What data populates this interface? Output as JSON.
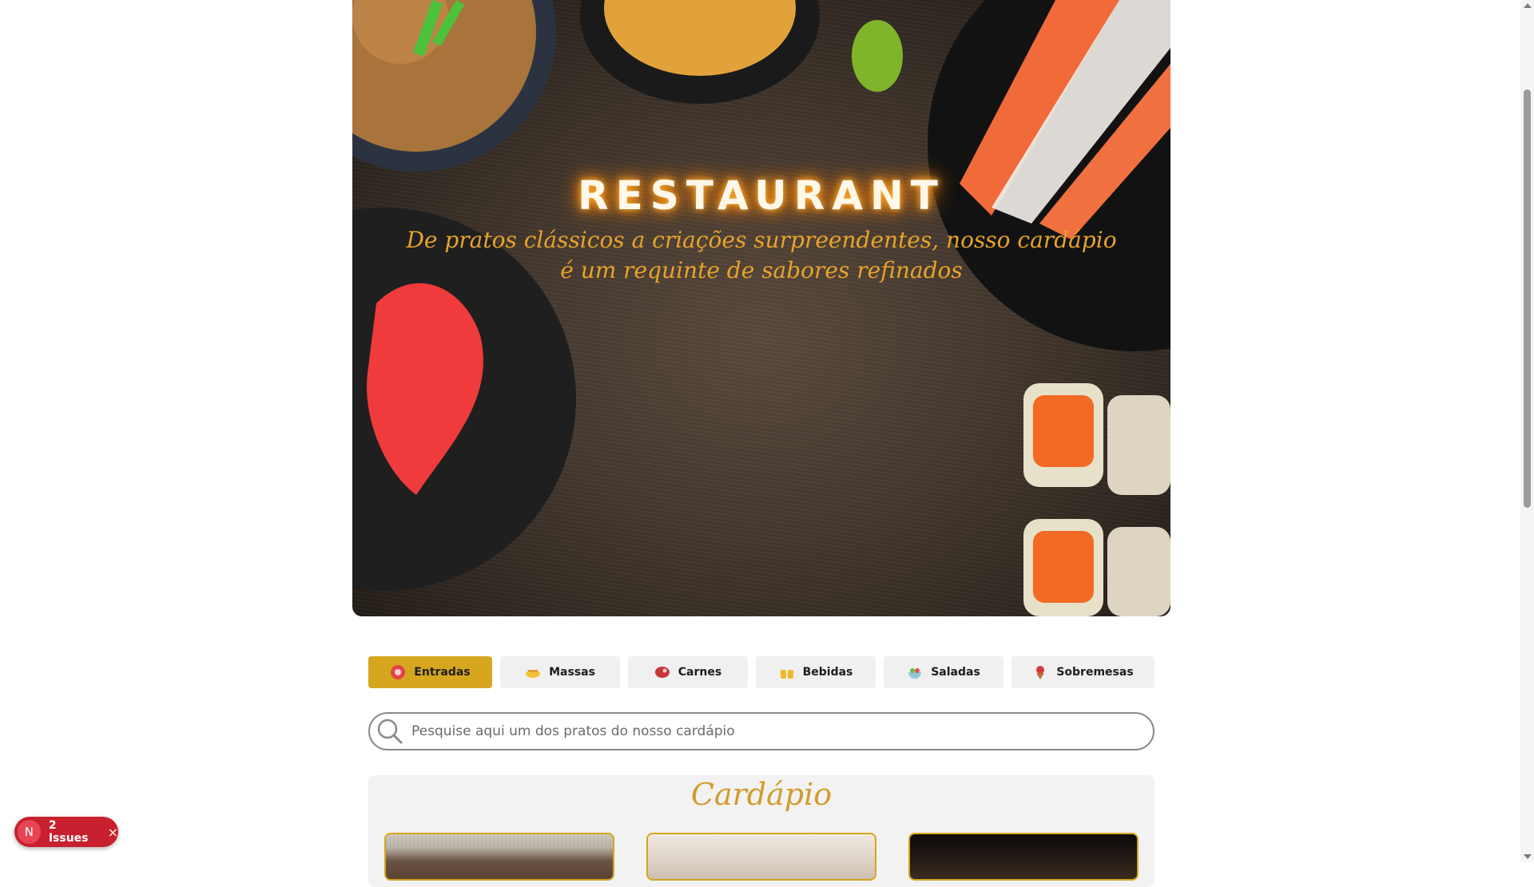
{
  "hero": {
    "title": "RESTAURANT",
    "subtitle": "De pratos clássicos a criações surpreendentes, nosso cardápio é um requinte de sabores refinados"
  },
  "categories": [
    {
      "label": "Entradas",
      "icon": "tomato-icon",
      "active": true
    },
    {
      "label": "Massas",
      "icon": "pasta-icon",
      "active": false
    },
    {
      "label": "Carnes",
      "icon": "meat-icon",
      "active": false
    },
    {
      "label": "Bebidas",
      "icon": "drinks-icon",
      "active": false
    },
    {
      "label": "Saladas",
      "icon": "salad-icon",
      "active": false
    },
    {
      "label": "Sobremesas",
      "icon": "dessert-icon",
      "active": false
    }
  ],
  "search": {
    "placeholder": "Pesquise aqui um dos pratos do nosso cardápio",
    "value": ""
  },
  "menu": {
    "title": "Cardápio"
  },
  "issues_badge": {
    "avatar_letter": "N",
    "label": "2 Issues",
    "close": "×"
  },
  "colors": {
    "accent": "#d6a61f",
    "title_glow": "#ff8a00",
    "subtitle": "#e8a32a",
    "menu_title": "#d49a2a",
    "issues_badge": "#c8202e"
  }
}
